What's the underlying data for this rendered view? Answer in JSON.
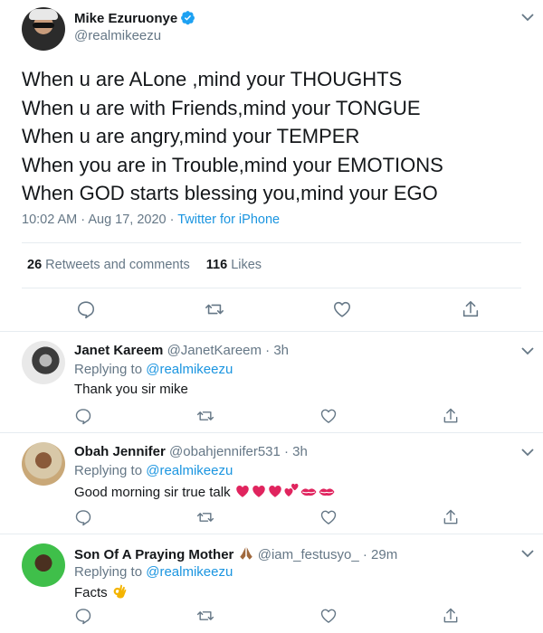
{
  "main": {
    "name": "Mike Ezuruonye",
    "handle": "@realmikeezu",
    "lines": [
      "When u are ALone ,mind your THOUGHTS",
      "When u are with Friends,mind your TONGUE",
      "When u are angry,mind your TEMPER",
      "When you are in Trouble,mind your EMOTIONS",
      "When GOD starts blessing you,mind your EGO"
    ],
    "timestamp": "10:02 AM · Aug 17, 2020 · ",
    "source": "Twitter for iPhone",
    "retweets_count": "26",
    "retweets_label": "Retweets and comments",
    "likes_count": "116",
    "likes_label": "Likes"
  },
  "replies": [
    {
      "name": "Janet Kareem",
      "handle": "@JanetKareem · 3h",
      "replying_prefix": "Replying to ",
      "replying_to": "@realmikeezu",
      "text": "Thank you sir mike"
    },
    {
      "name": "Obah Jennifer",
      "handle": "@obahjennifer531 · 3h",
      "replying_prefix": "Replying to ",
      "replying_to": "@realmikeezu",
      "text": "Good morning sir true talk "
    },
    {
      "name": "Son Of A Praying Mother ",
      "handle": "@iam_festusyo_ · 29m",
      "replying_prefix": "Replying to ",
      "replying_to": "@realmikeezu",
      "text": "Facts "
    }
  ],
  "icons": [
    "verified-badge-icon",
    "chevron-down-icon",
    "reply-icon",
    "retweet-icon",
    "like-icon",
    "share-icon",
    "praying-hands-emoji",
    "ok-hand-emoji",
    "heart-emoji",
    "kiss-mark-emoji"
  ],
  "colors": {
    "link": "#1b95e0",
    "secondary": "#657786",
    "primary_text": "#14171a",
    "divider": "#e6ecf0",
    "heart": "#e0245e"
  }
}
